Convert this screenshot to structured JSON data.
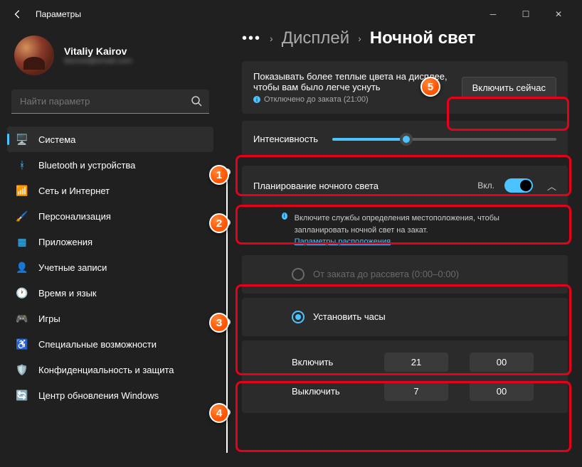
{
  "window": {
    "title": "Параметры"
  },
  "user": {
    "name": "Vitaliy Kairov",
    "email": "blurred@email.com"
  },
  "search": {
    "placeholder": "Найти параметр"
  },
  "nav": [
    {
      "label": "Система",
      "icon": "🖥️",
      "color": "#4cc2ff"
    },
    {
      "label": "Bluetooth и устройства",
      "icon": "ᚼ",
      "color": "#4cc2ff"
    },
    {
      "label": "Сеть и Интернет",
      "icon": "📶",
      "color": "#4cc2ff"
    },
    {
      "label": "Персонализация",
      "icon": "🖌️",
      "color": "#d4915c"
    },
    {
      "label": "Приложения",
      "icon": "▦",
      "color": "#4cc2ff"
    },
    {
      "label": "Учетные записи",
      "icon": "👤",
      "color": "#7ab8a0"
    },
    {
      "label": "Время и язык",
      "icon": "🕐",
      "color": "#4cc2ff"
    },
    {
      "label": "Игры",
      "icon": "🎮",
      "color": "#ccc"
    },
    {
      "label": "Специальные возможности",
      "icon": "♿",
      "color": "#4cc2ff"
    },
    {
      "label": "Конфиденциальность и защита",
      "icon": "🛡️",
      "color": "#4cc2ff"
    },
    {
      "label": "Центр обновления Windows",
      "icon": "🔄",
      "color": "#4cc2ff"
    }
  ],
  "breadcrumb": {
    "dots": "•••",
    "parent": "Дисплей",
    "current": "Ночной свет"
  },
  "description": {
    "main": "Показывать более теплые цвета на дисплее, чтобы вам было легче уснуть",
    "sub": "Отключено до заката (21:00)",
    "button": "Включить сейчас"
  },
  "intensity": {
    "label": "Интенсивность",
    "value": 33
  },
  "schedule": {
    "label": "Планирование ночного света",
    "state": "Вкл.",
    "locationMsg": "Включите службы определения местоположения, чтобы запланировать ночной свет на закат.",
    "locationLink": "Параметры расположения",
    "option1": "От заката до рассвета (0:00–0:00)",
    "option2": "Установить часы"
  },
  "times": {
    "onLabel": "Включить",
    "onHour": "21",
    "onMin": "00",
    "offLabel": "Выключить",
    "offHour": "7",
    "offMin": "00"
  },
  "badges": {
    "b1": "1",
    "b2": "2",
    "b3": "3",
    "b4": "4",
    "b5": "5"
  }
}
